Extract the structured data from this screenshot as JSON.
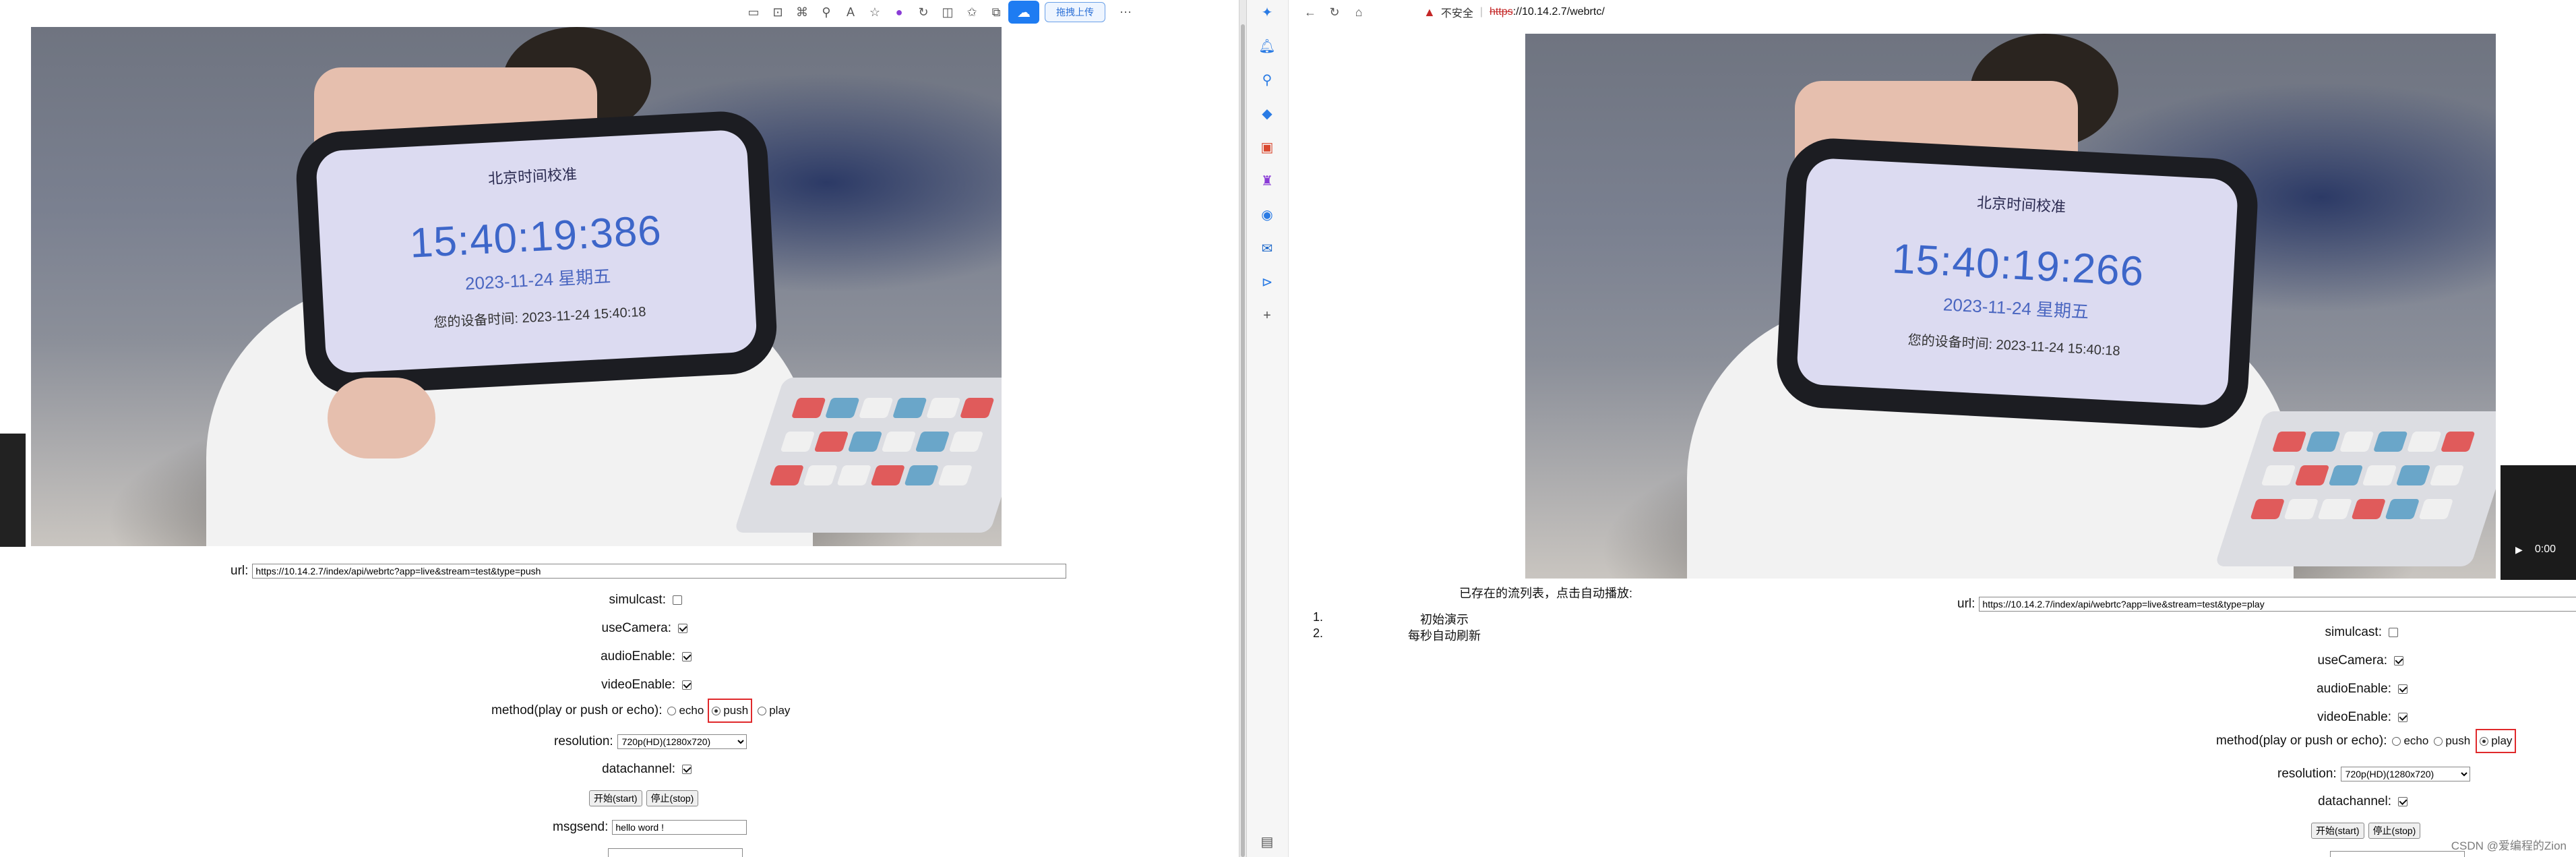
{
  "left_toolbar": {
    "upload_label": "拖拽上传"
  },
  "left_video": {
    "phone_header": "北京时间校准",
    "phone_time": "15:40:19:386",
    "phone_date": "2023-11-24 星期五",
    "phone_device": "您的设备时间:   2023-11-24 15:40:18"
  },
  "left_form": {
    "url_label": "url:",
    "url_value": "https://10.14.2.7/index/api/webrtc?app=live&stream=test&type=push",
    "simulcast_label": "simulcast:",
    "simulcast_checked": false,
    "useCamera_label": "useCamera:",
    "audioEnable_label": "audioEnable:",
    "videoEnable_label": "videoEnable:",
    "method_label": "method(play or push or echo):",
    "method_options": [
      "echo",
      "push",
      "play"
    ],
    "method_selected": "push",
    "resolution_label": "resolution:",
    "resolution_value": "720p(HD)(1280x720)",
    "datachannel_label": "datachannel:",
    "start_label": "开始(start)",
    "stop_label": "停止(stop)",
    "msgsend_label": "msgsend:",
    "msgsend_value": "hello word !"
  },
  "right_toolbar": {
    "insecure_label": "不安全",
    "url_scheme": "https",
    "url_rest": "://10.14.2.7/webrtc/"
  },
  "right_video": {
    "phone_header": "北京时间校准",
    "phone_time": "15:40:19:266",
    "phone_date": "2023-11-24 星期五",
    "phone_device": "您的设备时间:   2023-11-24 15:40:18",
    "thumb_time": "0:00"
  },
  "streams": {
    "heading": "已存在的流列表，点击自动播放:",
    "items": [
      {
        "num": "1.",
        "text": "初始演示"
      },
      {
        "num": "2.",
        "text": "每秒自动刷新"
      }
    ]
  },
  "right_form": {
    "url_label": "url:",
    "url_value": "https://10.14.2.7/index/api/webrtc?app=live&stream=test&type=play",
    "simulcast_label": "simulcast:",
    "useCamera_label": "useCamera:",
    "audioEnable_label": "audioEnable:",
    "videoEnable_label": "videoEnable:",
    "method_label": "method(play or push or echo):",
    "method_options": [
      "echo",
      "push",
      "play"
    ],
    "method_selected": "play",
    "resolution_label": "resolution:",
    "resolution_value": "720p(HD)(1280x720)",
    "datachannel_label": "datachannel:",
    "start_label": "开始(start)",
    "stop_label": "停止(stop)"
  },
  "watermark": "CSDN @爱编程的Zion",
  "colors": {
    "highlight": "#e0292b",
    "accent": "#1e7cf2",
    "insecure": "#c42727"
  }
}
